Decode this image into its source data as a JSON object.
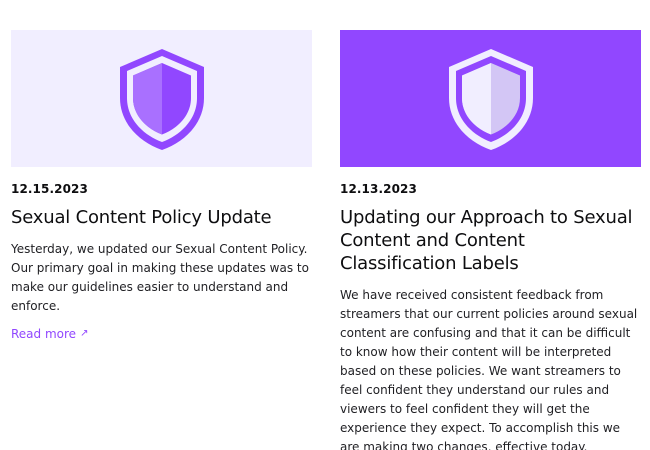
{
  "articles": [
    {
      "date": "12.15.2023",
      "title": "Sexual Content Policy Update",
      "description": "Yesterday, we updated our Sexual Content Policy. Our primary goal in making these updates was to make our guidelines easier to understand and enforce.",
      "link_label": "Read more",
      "link_icon": "arrow-up-right-icon",
      "image_icon": "shield-icon"
    },
    {
      "date": "12.13.2023",
      "title": "Updating our Approach to Sexual Content and Content Classification Labels",
      "description": "We have received consistent feedback from streamers that our current policies around sexual content are confusing and that it can be difficult to know how their content will be interpreted based on these policies. We want streamers to feel confident they understand our rules and viewers to feel confident they will get the experience they expect. To accomplish this we are making two changes, effective today.",
      "image_icon": "shield-icon"
    }
  ],
  "colors": {
    "accent": "#9147ff",
    "light_background": "#f1eeff",
    "text": "#0e0e10"
  }
}
